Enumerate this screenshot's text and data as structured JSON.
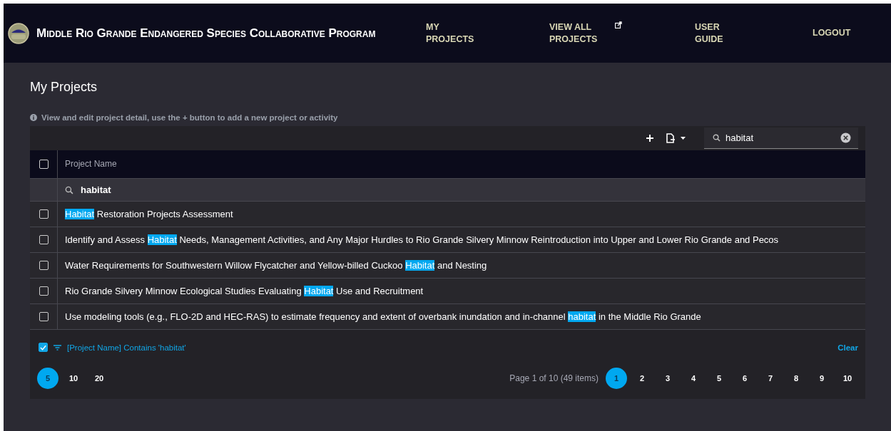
{
  "header": {
    "title": "Middle Rio Grande Endangered Species Collaborative Program",
    "nav": [
      {
        "label": "MY PROJECTS",
        "external": false
      },
      {
        "label": "VIEW ALL PROJECTS",
        "external": true
      },
      {
        "label": "USER GUIDE",
        "external": false
      },
      {
        "label": "LOGOUT",
        "external": false
      }
    ]
  },
  "page_title": "My Projects",
  "hint": "View and edit project detail, use the + button to add a new project or activity",
  "toolbar": {
    "search": {
      "value": "habitat"
    }
  },
  "table": {
    "select_all": {
      "checked": false
    },
    "column": "Project Name",
    "filter_value": "habitat",
    "rows": [
      {
        "checked": false,
        "before": "",
        "match": "Habitat",
        "after": " Restoration Projects Assessment"
      },
      {
        "checked": false,
        "before": "Identify and Assess ",
        "match": "Habitat",
        "after": " Needs, Management Activities, and Any Major Hurdles to Rio Grande Silvery Minnow Reintroduction into Upper and Lower Rio Grande and Pecos"
      },
      {
        "checked": false,
        "before": "Water Requirements for Southwestern Willow Flycatcher and Yellow-billed Cuckoo ",
        "match": "Habitat",
        "after": " and Nesting"
      },
      {
        "checked": false,
        "before": "Rio Grande Silvery Minnow Ecological Studies Evaluating ",
        "match": "Habitat",
        "after": " Use and Recruitment"
      },
      {
        "checked": false,
        "before": "Use modeling tools (e.g., FLO-2D and HEC-RAS) to estimate frequency and extent of overbank inundation and in-channel ",
        "match": "habitat",
        "after": " in the Middle Rio Grande"
      }
    ]
  },
  "filter": {
    "enabled": true,
    "text": "[Project Name] Contains 'habitat'",
    "clear": "Clear"
  },
  "pager": {
    "sizes": [
      {
        "label": "5",
        "selected": true
      },
      {
        "label": "10",
        "selected": false
      },
      {
        "label": "20",
        "selected": false
      }
    ],
    "info": "Page 1 of 10 (49 items)",
    "pages": [
      {
        "label": "1",
        "selected": true
      },
      {
        "label": "2",
        "selected": false
      },
      {
        "label": "3",
        "selected": false
      },
      {
        "label": "4",
        "selected": false
      },
      {
        "label": "5",
        "selected": false
      },
      {
        "label": "6",
        "selected": false
      },
      {
        "label": "7",
        "selected": false
      },
      {
        "label": "8",
        "selected": false
      },
      {
        "label": "9",
        "selected": false
      },
      {
        "label": "10",
        "selected": false
      }
    ]
  }
}
